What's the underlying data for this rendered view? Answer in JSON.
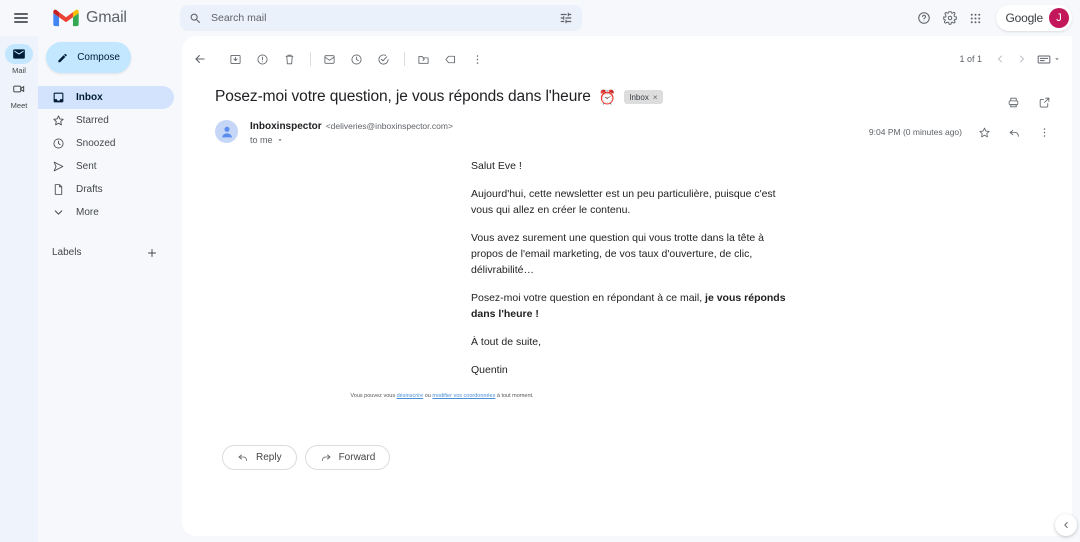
{
  "app": {
    "brand_name": "Gmail",
    "menu_icon": "hamburger-icon"
  },
  "search": {
    "placeholder": "Search mail",
    "value": "",
    "search_icon": "search-icon",
    "filter_icon": "tune-filter-icon"
  },
  "topbar": {
    "support_icon": "help-circle-icon",
    "settings_icon": "gear-icon",
    "apps_icon": "grid-apps-icon",
    "account_brand": "Google",
    "account_initial": "J",
    "account_color": "#c2185b"
  },
  "rail": {
    "items": [
      {
        "label": "Mail",
        "icon": "mail-icon",
        "active": true
      },
      {
        "label": "Meet",
        "icon": "video-camera-icon",
        "active": false
      }
    ]
  },
  "sidebar": {
    "compose_label": "Compose",
    "compose_icon": "pencil-icon",
    "items": [
      {
        "label": "Inbox",
        "icon": "inbox-icon",
        "active": true
      },
      {
        "label": "Starred",
        "icon": "star-icon",
        "active": false
      },
      {
        "label": "Snoozed",
        "icon": "clock-icon",
        "active": false
      },
      {
        "label": "Sent",
        "icon": "send-icon",
        "active": false
      },
      {
        "label": "Drafts",
        "icon": "file-icon",
        "active": false
      },
      {
        "label": "More",
        "icon": "chevron-down-icon",
        "active": false
      }
    ],
    "labels_title": "Labels",
    "labels_add_icon": "plus-icon"
  },
  "toolbar": {
    "back_icon": "arrow-back-icon",
    "archive_icon": "archive-icon",
    "spam_icon": "report-spam-icon",
    "delete_icon": "trash-icon",
    "unread_icon": "mark-unread-icon",
    "snooze_icon": "snooze-clock-icon",
    "tasks_icon": "add-to-tasks-icon",
    "move_icon": "move-to-folder-icon",
    "label_icon": "label-tag-icon",
    "more_icon": "more-vertical-icon",
    "pager_text": "1 of 1",
    "prev_icon": "chevron-left-icon",
    "next_icon": "chevron-right-icon",
    "density_icon": "display-density-icon",
    "density_caret": "caret-down-icon"
  },
  "email": {
    "subject": "Posez-moi votre question, je vous réponds dans l'heure",
    "subject_emoji": "⏰",
    "label_chip": "Inbox",
    "label_chip_remove": "×",
    "print_icon": "print-icon",
    "open_new_icon": "open-in-new-icon",
    "sender_name": "Inboxinspector",
    "sender_email": "<deliveries@inboxinspector.com>",
    "recipient": "to me",
    "recipient_caret": "caret-down-icon",
    "timestamp": "9:04 PM (0 minutes ago)",
    "star_icon": "star-outline-icon",
    "reply_icon": "reply-arrow-icon",
    "more_icon": "more-vertical-icon",
    "avatar_icon": "person-avatar-icon",
    "body": {
      "greeting": "Salut Eve !",
      "paragraph_1": "Aujourd'hui, cette newsletter est un peu particulière, puisque c'est vous qui allez en créer le contenu.",
      "paragraph_2": "Vous avez surement une question qui vous trotte dans la tête à propos de l'email marketing, de vos taux d'ouverture, de clic, délivrabilité…",
      "paragraph_3_plain": "Posez-moi votre question en répondant à ce mail, ",
      "paragraph_3_bold": "je vous réponds dans l'heure !",
      "closing": "À tout de suite,",
      "signature": "Quentin"
    },
    "footer": {
      "prefix": "Vous pouvez vous ",
      "link_1": "désinscrire",
      "middle": " ou ",
      "link_2": "modifier vos coordonnées",
      "suffix": " à tout moment."
    },
    "actions": {
      "reply_label": "Reply",
      "reply_icon": "reply-arrow-icon",
      "forward_label": "Forward",
      "forward_icon": "forward-arrow-icon"
    }
  },
  "footer_fab": {
    "icon": "chevron-left-icon"
  }
}
